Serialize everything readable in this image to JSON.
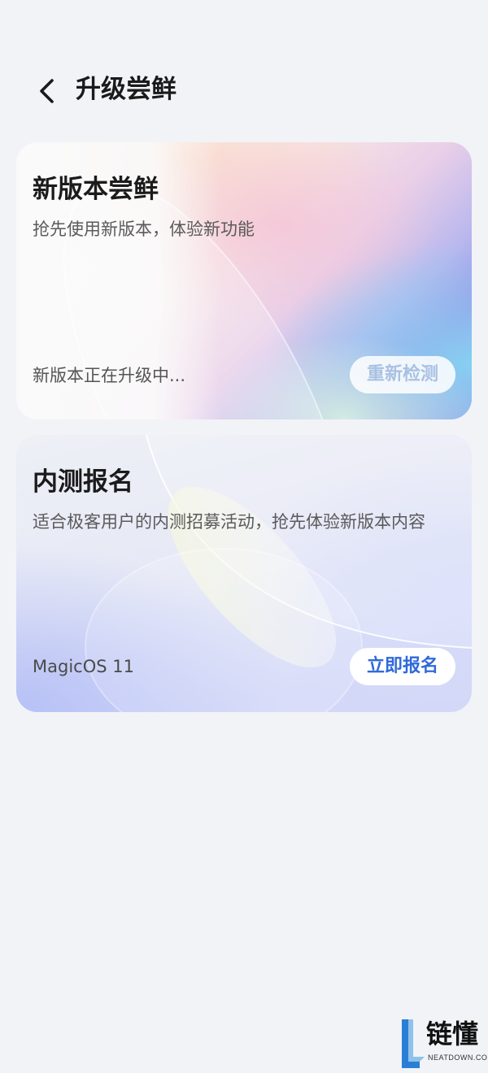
{
  "header": {
    "title": "升级尝鲜",
    "back_icon": "chevron-left-icon"
  },
  "card_new_version": {
    "title": "新版本尝鲜",
    "description": "抢先使用新版本，体验新功能",
    "status": "新版本正在升级中...",
    "button_label": "重新检测"
  },
  "card_beta": {
    "title": "内测报名",
    "description": "适合极客用户的内测招募活动，抢先体验新版本内容",
    "version": "MagicOS 11",
    "button_label": "立即报名"
  },
  "watermark": {
    "brand": "链懂",
    "domain": "NEATDOWN.COM"
  },
  "colors": {
    "background": "#f1f3f7",
    "accent_blue": "#2f6ad8",
    "disabled_button_text": "#a9c1e3"
  }
}
